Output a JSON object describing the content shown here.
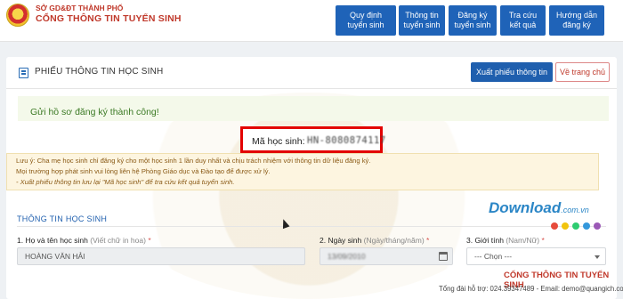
{
  "header": {
    "dept": "SỞ GD&ĐT THÀNH PHỐ",
    "portal": "CỔNG THÔNG TIN TUYỂN SINH",
    "nav": [
      {
        "label": "Quy định tuyển sinh"
      },
      {
        "label": "Thông tin tuyển sinh"
      },
      {
        "label": "Đăng ký tuyển sinh"
      },
      {
        "label": "Tra cứu kết quả"
      },
      {
        "label": "Hướng dẫn đăng ký"
      }
    ]
  },
  "card": {
    "title": "PHIẾU THÔNG TIN HỌC SINH",
    "export_label": "Xuất phiếu thông tin",
    "home_label": "Về trang chủ",
    "success": "Gửi hồ sơ đăng ký thành công!",
    "code_label": "Mã học sinh:",
    "code_value": "HN-8080874117",
    "notes": [
      "Lưu ý: Cha mẹ học sinh chỉ đăng ký cho một học sinh 1 lần duy nhất và chịu trách nhiệm với thông tin dữ liệu đăng ký.",
      "Mọi trường hợp phát sinh vui lòng liên hệ Phòng Giáo dục và Đào tạo để được xử lý.",
      "- Xuất phiếu thông tin lưu lại \"Mã học sinh\" để tra cứu kết quả tuyển sinh."
    ]
  },
  "form": {
    "section_title": "THÔNG TIN HỌC SINH",
    "name_label": "1. Họ và tên học sinh",
    "name_hint": "(Viết chữ in hoa)",
    "name_value": "HOÀNG VĂN HẢI",
    "dob_label": "2. Ngày sinh",
    "dob_hint": "(Ngày/tháng/năm)",
    "dob_value": "13/09/2010",
    "gender_label": "3. Giới tính",
    "gender_hint": "(Nam/Nữ)",
    "gender_value": "--- Chọn ---",
    "required_mark": "*"
  },
  "footer": {
    "title": "CỔNG THÔNG TIN TUYỂN SINH",
    "contact": "Tổng đài hỗ trợ: 024.39347489 - Email: demo@quangich.com"
  },
  "watermark": {
    "brand": "Download",
    "suffix": ".com.vn",
    "dot_colors": [
      "#e74c3c",
      "#f1c40f",
      "#2ecc71",
      "#3498db",
      "#9b59b6"
    ]
  }
}
